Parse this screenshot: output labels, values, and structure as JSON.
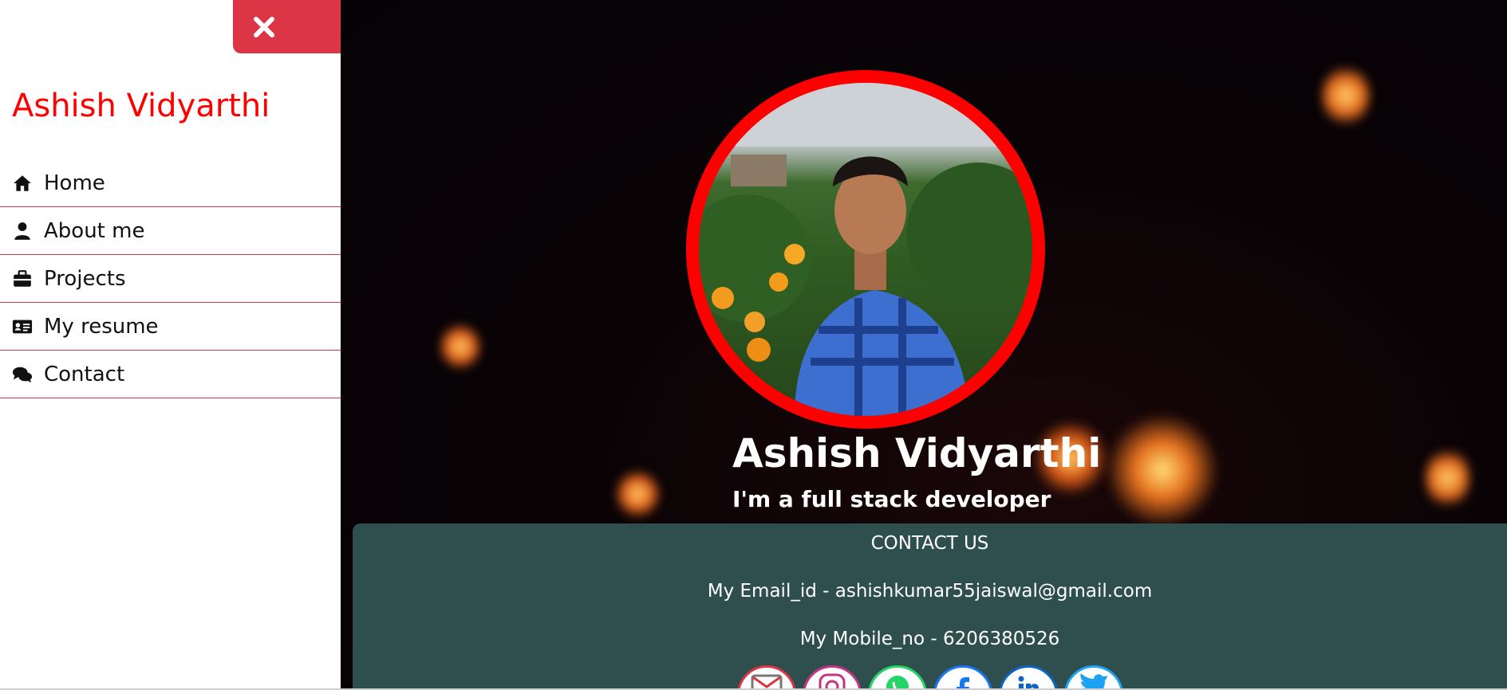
{
  "sidebar": {
    "brand": "Ashish Vidyarthi",
    "close_icon": "close-icon",
    "items": [
      {
        "label": "Home",
        "icon": "home-icon"
      },
      {
        "label": "About me",
        "icon": "user-icon"
      },
      {
        "label": "Projects",
        "icon": "briefcase-icon"
      },
      {
        "label": "My resume",
        "icon": "id-card-icon"
      },
      {
        "label": "Contact",
        "icon": "comments-icon"
      }
    ]
  },
  "hero": {
    "name": "Ashish Vidyarthi",
    "tagline": "I'm a full stack developer"
  },
  "contact": {
    "title": "CONTACT US",
    "email_line": "My Email_id - ashishkumar55jaiswal@gmail.com",
    "mobile_line": "My Mobile_no - 6206380526",
    "socials": [
      {
        "icon": "gmail-icon",
        "color": "#dc3545"
      },
      {
        "icon": "instagram-icon",
        "color": "#c13584"
      },
      {
        "icon": "whatsapp-icon",
        "color": "#25d366"
      },
      {
        "icon": "facebook-icon",
        "color": "#1877f2"
      },
      {
        "icon": "linkedin-icon",
        "color": "#0a66c2"
      },
      {
        "icon": "twitter-icon",
        "color": "#1da1f2"
      }
    ]
  },
  "colors": {
    "accent": "#ff0000",
    "close_button": "#dc3545",
    "contact_bg": "#2f4f4f"
  }
}
